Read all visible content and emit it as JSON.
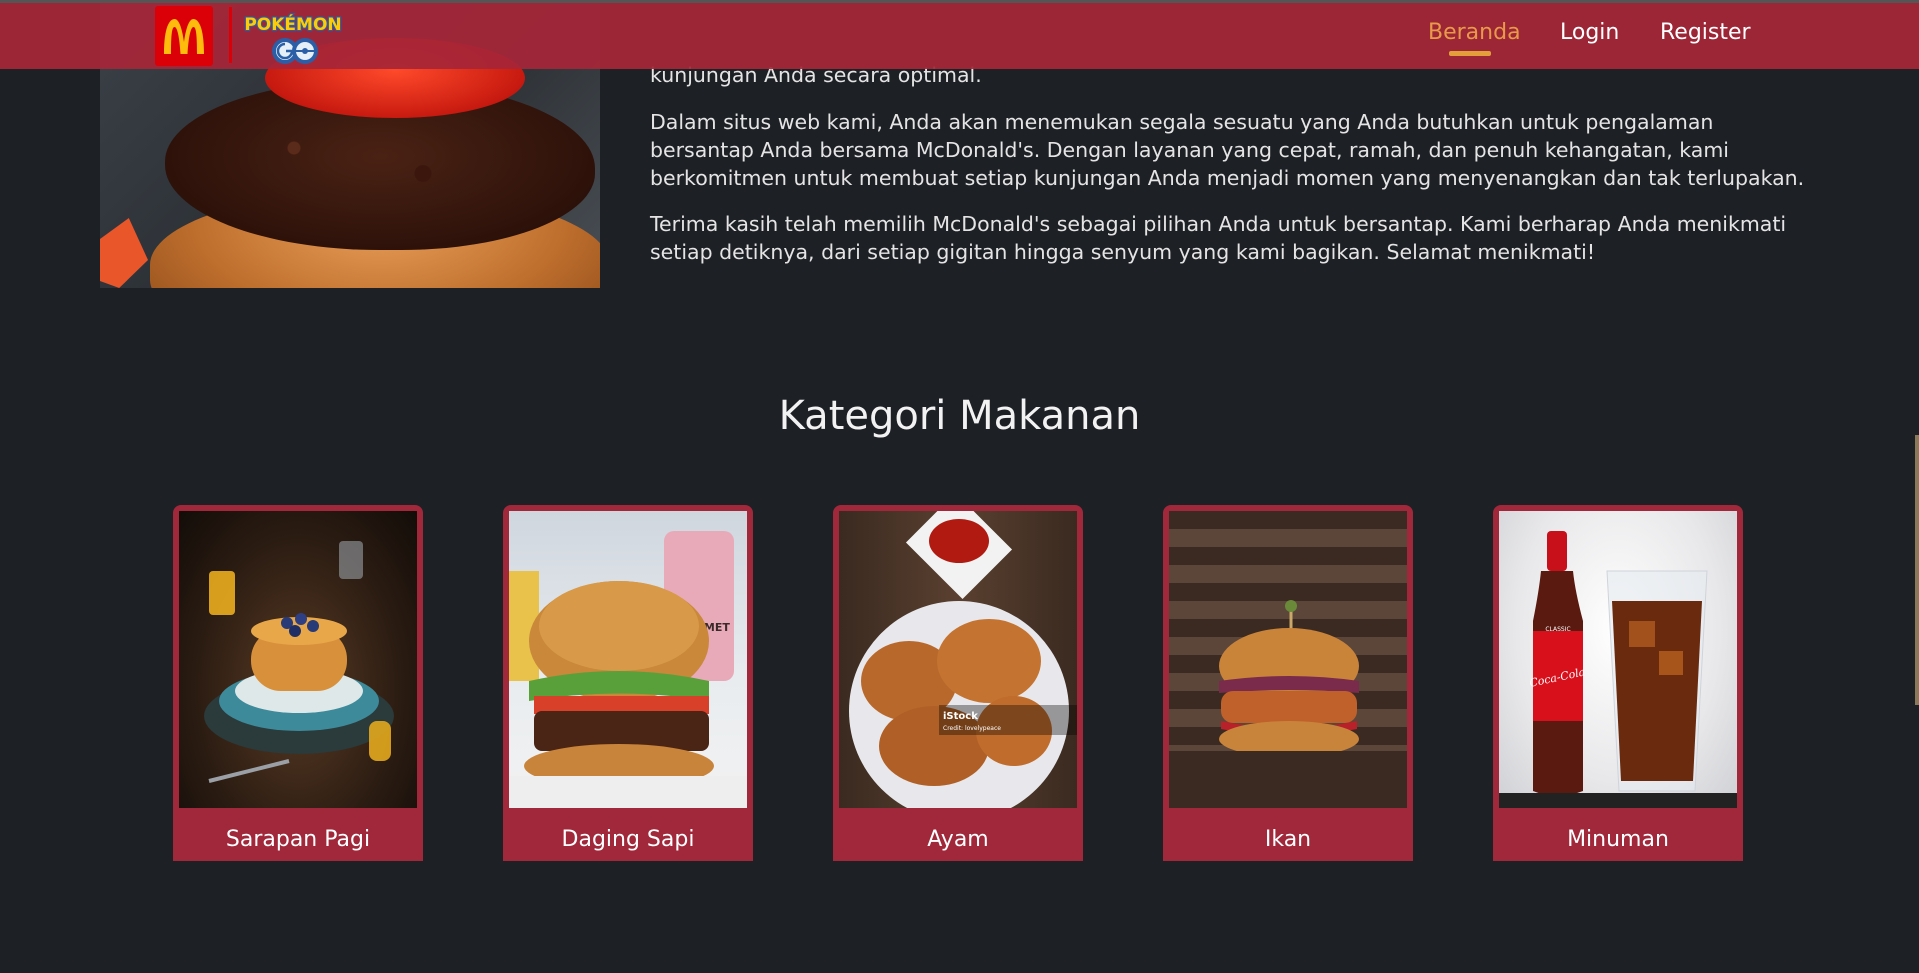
{
  "navbar": {
    "brand_mc_letter": "M",
    "brand_pogo_top": "POKÉMON",
    "brand_pogo_bottom": "GO",
    "links": [
      {
        "label": "Beranda",
        "active": true
      },
      {
        "label": "Login",
        "active": false
      },
      {
        "label": "Register",
        "active": false
      }
    ],
    "accent_color": "#e3a03a",
    "background_color": "#a62638"
  },
  "about": {
    "partial_line": "kunjungan Anda secara optimal.",
    "paragraph_2": "Dalam situs web kami, Anda akan menemukan segala sesuatu yang Anda butuhkan untuk pengalaman bersantap Anda bersama McDonald's. Dengan layanan yang cepat, ramah, dan penuh kehangatan, kami berkomitmen untuk membuat setiap kunjungan Anda menjadi momen yang menyenangkan dan tak terlupakan.",
    "paragraph_3": "Terima kasih telah memilih McDonald's sebagai pilihan Anda untuk bersantap. Kami berharap Anda menikmati setiap detiknya, dari setiap gigitan hingga senyum yang kami bagikan. Selamat menikmati!"
  },
  "categories": {
    "title": "Kategori Makanan",
    "items": [
      {
        "label": "Sarapan Pagi",
        "image": "pancakes-photo"
      },
      {
        "label": "Daging Sapi",
        "image": "beef-burger-photo"
      },
      {
        "label": "Ayam",
        "image": "fried-chicken-photo",
        "watermark": "iStock",
        "watermark_credit": "Credit: lovelypeace"
      },
      {
        "label": "Ikan",
        "image": "fish-burger-photo"
      },
      {
        "label": "Minuman",
        "image": "coca-cola-photo",
        "bottle_text": "Coca-Cola",
        "bottle_badge": "CLASSIC"
      }
    ]
  },
  "colors": {
    "page_background": "#1d2025",
    "card_background": "#a0283a",
    "mc_red": "#db0007",
    "mc_yellow": "#ffbc0d"
  }
}
